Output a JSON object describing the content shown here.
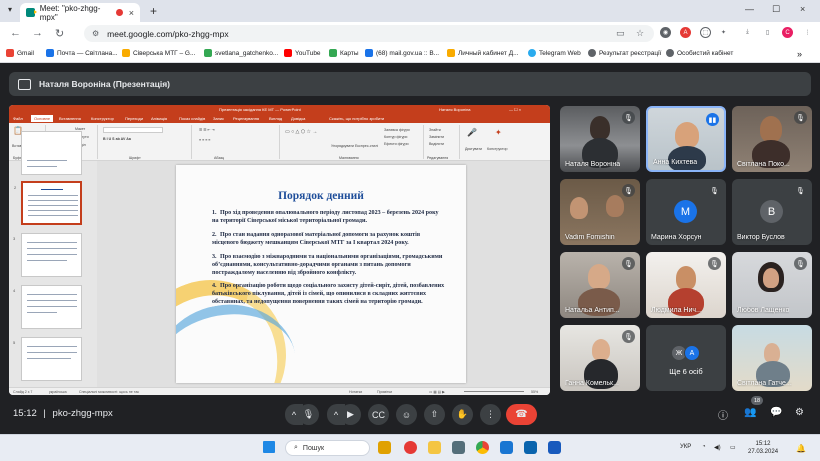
{
  "browser": {
    "tab_title": "Meet: \"pko-zhgg-mpx\"",
    "tab_close": "×",
    "new_tab": "+",
    "url": "meet.google.com/pko-zhgg-mpx",
    "window_controls": [
      "—",
      "☐",
      "×"
    ],
    "profile_initial": "C"
  },
  "bookmarks": [
    {
      "label": "Gmail",
      "color": "#ea4335"
    },
    {
      "label": "Почта — Світлана...",
      "color": "#1a73e8"
    },
    {
      "label": "Сіверська МТГ – G...",
      "color": "#f9ab00"
    },
    {
      "label": "svetlana_gatchenko...",
      "color": "#34a853"
    },
    {
      "label": "YouTube",
      "color": "#ff0000"
    },
    {
      "label": "Карты",
      "color": "#34a853"
    },
    {
      "label": "(68) mail.gov.ua :: В...",
      "color": "#1a73e8"
    },
    {
      "label": "Личный кабинет Д...",
      "color": "#f9ab00"
    },
    {
      "label": "Telegram Web",
      "color": "#2aabee"
    },
    {
      "label": "Результат реєстрації",
      "color": "#5f6368"
    },
    {
      "label": "Особистий кабінет",
      "color": "#5f6368"
    }
  ],
  "meet": {
    "presenter_label": "Наталя Вороніна (Презентація)",
    "meeting_time": "15:12",
    "meeting_code": "pko-zhgg-mpx",
    "participant_count": "18",
    "participants": [
      {
        "name": "Наталя Вороніна",
        "type": "camera",
        "muted": true
      },
      {
        "name": "Анна Кихтева",
        "type": "camera",
        "muted": false,
        "speaking": true
      },
      {
        "name": "Світлана Поко...",
        "type": "camera",
        "muted": true
      },
      {
        "name": "Vadim Fomishin",
        "type": "camera",
        "muted": true
      },
      {
        "name": "Марина Хорсун",
        "type": "avatar",
        "initial": "M",
        "color": "#1a73e8",
        "muted": true
      },
      {
        "name": "Виктор Буслов",
        "type": "avatar",
        "initial": "B",
        "color": "#5f6368",
        "muted": true
      },
      {
        "name": "Натальа Антип...",
        "type": "camera",
        "muted": true
      },
      {
        "name": "Людмила Нич...",
        "type": "camera",
        "muted": true
      },
      {
        "name": "Любов Лащенко",
        "type": "camera",
        "muted": true
      },
      {
        "name": "Ганна Комельк...",
        "type": "camera",
        "muted": true
      },
      {
        "name": "Ще 6 осіб",
        "type": "more",
        "initials": [
          "Ж",
          "A"
        ]
      },
      {
        "name": "Світлана Гатче...",
        "type": "camera",
        "muted": true
      }
    ]
  },
  "ppt": {
    "window_title": "Презентація засідання КЕ МТ — PowerPoint",
    "user_name": "Наталя Вороніна",
    "search_hint": "Скажіть, що потрібно зробити",
    "tabs": [
      "Файл",
      "Основне",
      "Вставлення",
      "Конструктор",
      "Переходи",
      "Анімація",
      "Показ слайдів",
      "Запис",
      "Рецензування",
      "Вигляд",
      "Довідка"
    ],
    "ribbon": {
      "paste": "Вставити",
      "create_slide": "Створити слайд",
      "layout": "Макет",
      "reset": "Скинути",
      "section": "Розділ",
      "arrange": "Упорядкувати",
      "quick_styles": "Експрес-стилі",
      "fill": "Заливка фігури",
      "outline": "Контур фігури",
      "effects": "Ефекти фігури",
      "find": "Знайти",
      "replace": "Замінити",
      "select": "Виділити",
      "dictate": "Диктувати",
      "designer": "Конструктор",
      "group_clipboard": "Буфер обміну",
      "group_slides": "Слайди",
      "group_font": "Шрифт",
      "group_paragraph": "Абзац",
      "group_drawing": "Малювання",
      "group_editing": "Редагування"
    },
    "slide": {
      "title": "Порядок денний",
      "items": [
        {
          "n": "1.",
          "text": "Про хід проведення опалювального періоду листопад 2023 – березень 2024 року на території Сіверської міської територіальної громади."
        },
        {
          "n": "2.",
          "text": "Про стан надання одноразової матеріальної допомоги за рахунок коштів місцевого бюджету мешканцям Сіверської МТГ за I квартал 2024 року."
        },
        {
          "n": "3.",
          "text": "Про взаємодію з міжнародними та національними організаціями, громадськими об’єднаннями, консультативно-дорадчими органами з питань допомоги постраждалому населенню від збройного конфлікту."
        },
        {
          "n": "4.",
          "text": "Про організацію роботи щодо соціального захисту дітей-сиріт, дітей, позбавлених батьківського піклування, дітей із сімей, що опинилися в складних життєвих обставинах, та недопущення повернення таких сімей на територію громади."
        }
      ]
    },
    "status": {
      "slide_count": "Слайд 2 з 7",
      "language": "українська",
      "accessibility": "Спеціальні можливості: щось не так",
      "notes": "Нотатки",
      "comments": "Примітки",
      "zoom": "55%"
    }
  },
  "taskbar": {
    "search": "Пошук",
    "language": "УКР",
    "time": "15:12",
    "date": "27.03.2024"
  }
}
